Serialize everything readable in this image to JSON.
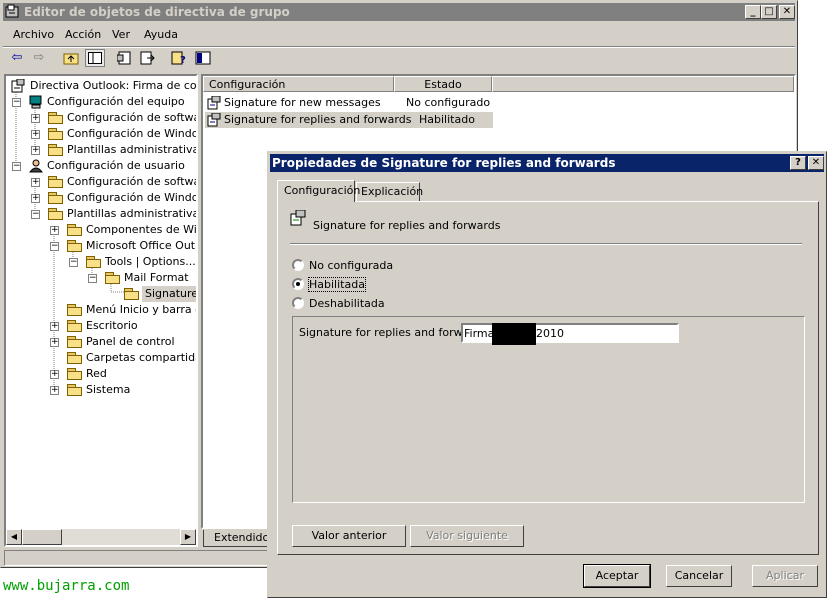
{
  "main_window": {
    "title": "Editor de objetos de directiva de grupo",
    "menu": [
      "Archivo",
      "Acción",
      "Ver",
      "Ayuda"
    ],
    "toolbar_icons": [
      "back-arrow-icon",
      "forward-arrow-icon",
      "up-folder-icon",
      "show-hide-tree-icon",
      "properties-icon",
      "export-list-icon",
      "help-icon",
      "console-tree-icon"
    ]
  },
  "tree": {
    "root": "Directiva Outlook: Firma de correo",
    "computer_config": "Configuración del equipo",
    "cc_software": "Configuración de software",
    "cc_windows": "Configuración de Windows",
    "cc_admin": "Plantillas administrativas",
    "user_config": "Configuración de usuario",
    "uc_software": "Configuración de software",
    "uc_windows": "Configuración de Windows",
    "uc_admin": "Plantillas administrativas",
    "components": "Componentes de Wind",
    "office": "Microsoft Office Outloc",
    "tools": "Tools | Options...",
    "mail_format": "Mail Format",
    "signature": "Signature",
    "start_menu": "Menú Inicio y barra de",
    "desktop": "Escritorio",
    "control_panel": "Panel de control",
    "shared_folders": "Carpetas compartidas",
    "network": "Red",
    "system": "Sistema"
  },
  "list": {
    "col_setting": "Configuración",
    "col_state": "Estado",
    "rows": [
      {
        "setting": "Signature for new messages",
        "state": "No configurado"
      },
      {
        "setting": "Signature for replies and forwards",
        "state": "Habilitado"
      }
    ],
    "tab_extended": "Extendido"
  },
  "dialog": {
    "title": "Propiedades de Signature for replies and forwards",
    "tabs": [
      "Configuración",
      "Explicación"
    ],
    "policy_name": "Signature for replies and forwards",
    "options": [
      "No configurada",
      "Habilitada",
      "Deshabilitada"
    ],
    "selected_option": "Habilitada",
    "field_label": "Signature for replies and forwards",
    "field_value_prefix": "Firma",
    "field_value_suffix": "2010",
    "btn_prev": "Valor anterior",
    "btn_next": "Valor siguiente",
    "btn_ok": "Aceptar",
    "btn_cancel": "Cancelar",
    "btn_apply": "Aplicar"
  },
  "watermark": "www.bujarra.com",
  "colors": {
    "active_title": "#0a246a",
    "inactive_title": "#808080",
    "face": "#d4d0c8",
    "watermark": "#00a000"
  }
}
